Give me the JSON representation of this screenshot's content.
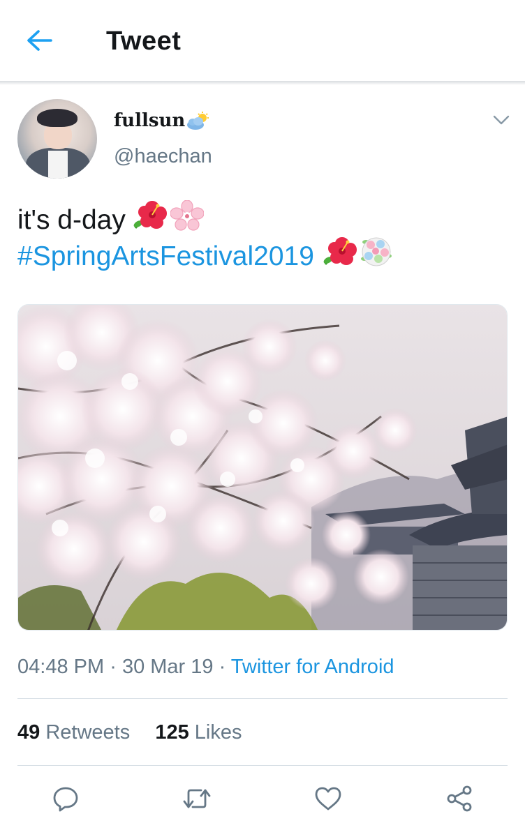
{
  "header": {
    "title": "Tweet",
    "back_icon": "arrow-left-icon",
    "accent": "#1da1f2"
  },
  "author": {
    "display_name": "fullsun",
    "handle": "@haechan",
    "name_icon": "sun-behind-cloud-icon"
  },
  "tweet": {
    "line1_text": "it's d-day",
    "line1_emojis": [
      "hibiscus-emoji",
      "cherry-blossom-emoji"
    ],
    "hashtag": "#SpringArtsFestival2019",
    "line2_emojis": [
      "hibiscus-emoji",
      "bouquet-emoji"
    ]
  },
  "media": {
    "description_icon": "photo-cherry-blossom-palace"
  },
  "meta": {
    "time": "04:48 PM",
    "separator1": "·",
    "date": "30 Mar 19",
    "separator2": "·",
    "source": "Twitter for Android"
  },
  "stats": {
    "retweets_count": "49",
    "retweets_label": "Retweets",
    "likes_count": "125",
    "likes_label": "Likes"
  },
  "actions": [
    {
      "name": "reply-icon"
    },
    {
      "name": "retweet-icon"
    },
    {
      "name": "like-icon"
    },
    {
      "name": "share-icon"
    }
  ],
  "colors": {
    "link": "#1b95e0",
    "secondary_text": "#657786",
    "primary_text": "#14171a",
    "divider": "#d8e0e6"
  }
}
